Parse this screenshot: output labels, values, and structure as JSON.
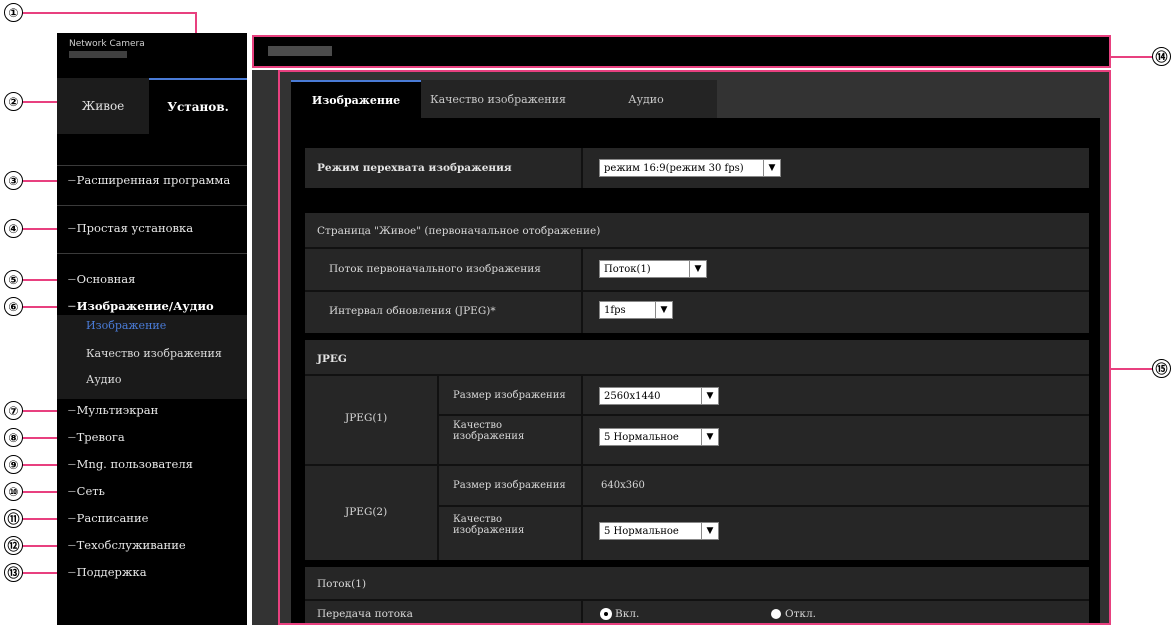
{
  "callouts": [
    "①",
    "②",
    "③",
    "④",
    "⑤",
    "⑥",
    "⑦",
    "⑧",
    "⑨",
    "⑩",
    "⑪",
    "⑫",
    "⑬",
    "⑭",
    "⑮"
  ],
  "header": {
    "logo_text": "Network Camera"
  },
  "top_tabs": {
    "live": "Живое",
    "setup": "Установ."
  },
  "menu": {
    "advanced": "Расширенная программа",
    "simple": "Простая установка",
    "basic": "Основная",
    "image_audio": "Изображение/Аудио",
    "sub_image": "Изображение",
    "sub_quality": "Качество изображения",
    "sub_audio": "Аудио",
    "multiscreen": "Мультиэкран",
    "alarm": "Тревога",
    "users": "Мng. пользователя",
    "network": "Сеть",
    "schedule": "Расписание",
    "maintenance": "Техобслуживание",
    "support": "Поддержка",
    "dash": "−"
  },
  "page_tabs": [
    "Изображение",
    "Качество изображения",
    "Аудио"
  ],
  "form": {
    "capture_mode_label": "Режим перехвата изображения",
    "capture_mode_value": "режим 16:9(режим 30 fps)",
    "live_page_header": "Страница \"Живое\" (первоначальное отображение)",
    "initial_stream_label": "Поток первоначального изображения",
    "initial_stream_value": "Поток(1)",
    "refresh_label": "Интервал обновления (JPEG)*",
    "refresh_value": "1fps",
    "jpeg_header": "JPEG",
    "jpeg1_label": "JPEG(1)",
    "jpeg2_label": "JPEG(2)",
    "size_label": "Размер изображения",
    "jpeg1_size_value": "2560x1440",
    "jpeg2_size_value": "640x360",
    "quality_label": "Качество изображения",
    "jpeg1_quality_value": "5 Нормальное",
    "jpeg2_quality_value": "5 Нормальное",
    "stream1_header": "Поток(1)",
    "stream_tx_label": "Передача потока",
    "radio_on": "Вкл.",
    "radio_off": "Откл."
  },
  "colors": {
    "callout_line": "#e8407f",
    "active_tab_accent": "#4a7bd6"
  }
}
